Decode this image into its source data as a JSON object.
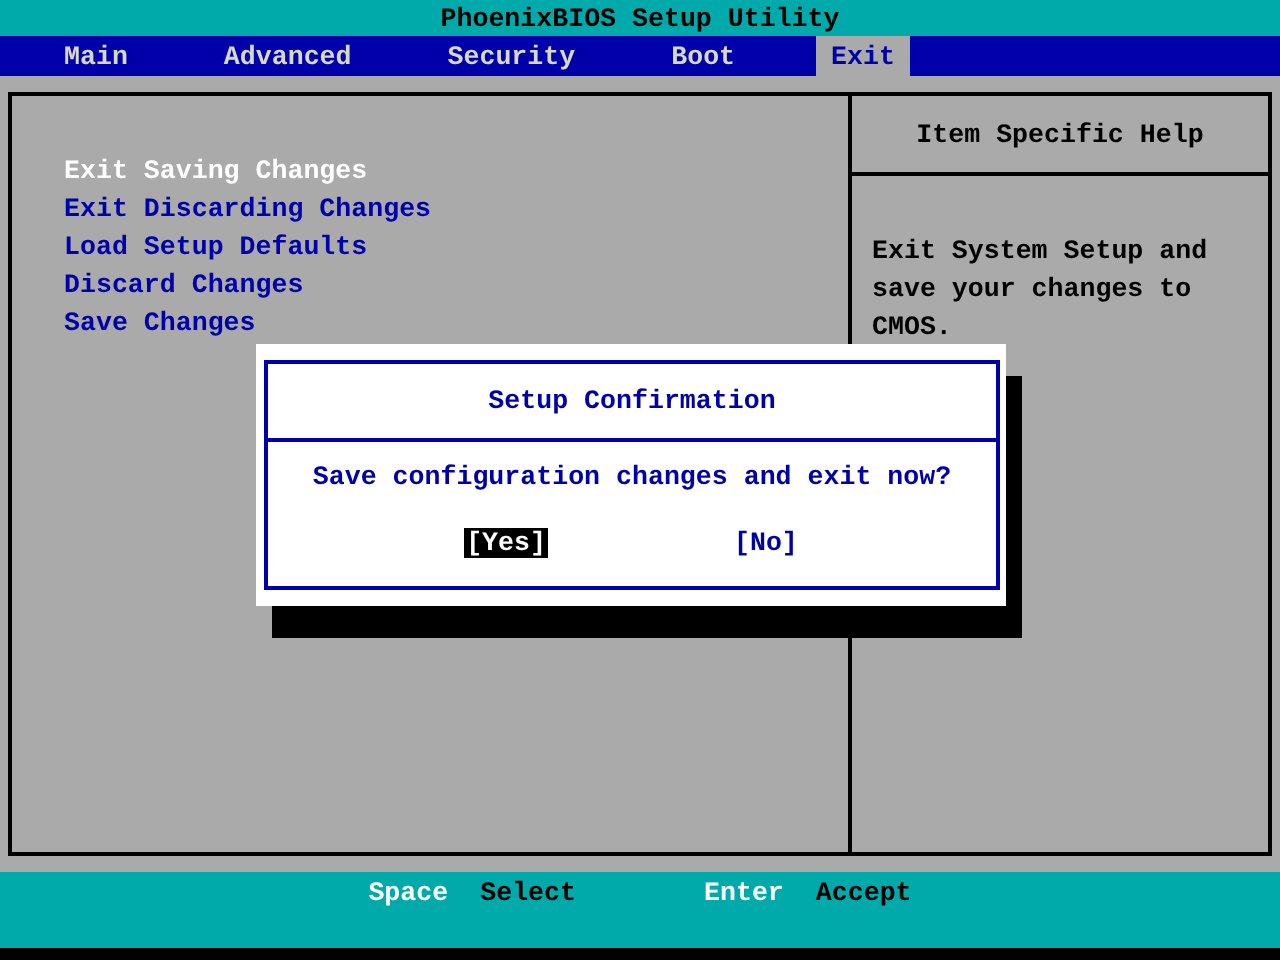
{
  "title": "PhoenixBIOS Setup Utility",
  "tabs": [
    {
      "label": "Main",
      "selected": false
    },
    {
      "label": "Advanced",
      "selected": false
    },
    {
      "label": "Security",
      "selected": false
    },
    {
      "label": "Boot",
      "selected": false
    },
    {
      "label": "Exit",
      "selected": true
    }
  ],
  "menu": [
    {
      "label": "Exit Saving Changes",
      "selected": true
    },
    {
      "label": "Exit Discarding Changes",
      "selected": false
    },
    {
      "label": "Load Setup Defaults",
      "selected": false
    },
    {
      "label": "Discard Changes",
      "selected": false
    },
    {
      "label": "Save Changes",
      "selected": false
    }
  ],
  "help": {
    "title": "Item Specific Help",
    "text": "Exit System Setup and save your changes to CMOS."
  },
  "dialog": {
    "title": "Setup Confirmation",
    "message": "Save configuration changes and exit now?",
    "buttons": [
      {
        "label": "[Yes]",
        "selected": true
      },
      {
        "label": "[No]",
        "selected": false
      }
    ]
  },
  "footer": [
    {
      "key": "Space",
      "action": "Select"
    },
    {
      "key": "Enter",
      "action": "Accept"
    }
  ]
}
